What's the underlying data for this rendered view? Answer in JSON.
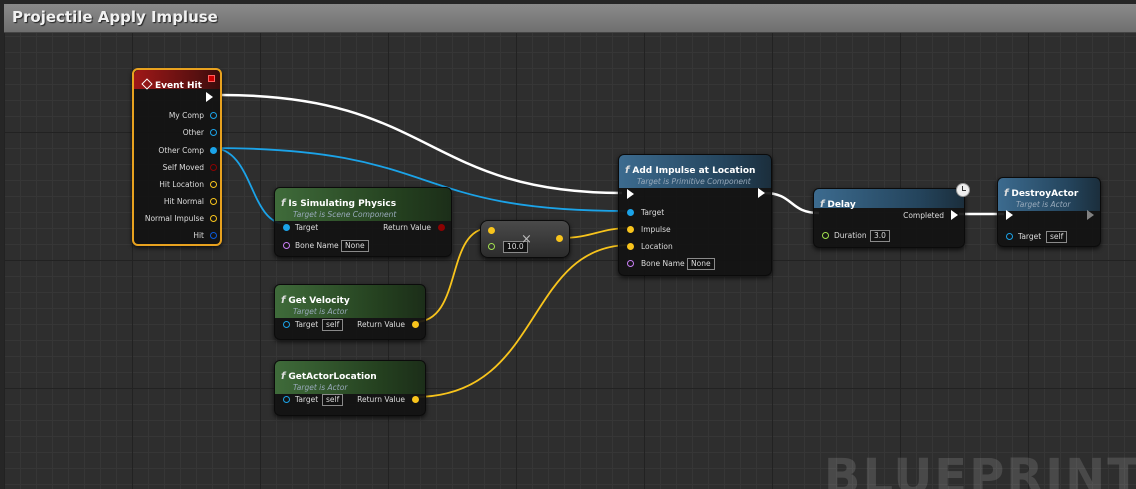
{
  "editor": {
    "title": "Projectile Apply Impluse",
    "watermark": "BLUEPRINT"
  },
  "colors": {
    "exec": "#ffffff",
    "object": "#1ba3e8",
    "vector": "#f8c41c",
    "float": "#a2e04e",
    "bool": "#8c0202",
    "struct": "#0a5adb",
    "name": "#c97ff5",
    "selection": "#e8a21f"
  },
  "nodes": {
    "event_hit": {
      "title": "Event Hit",
      "pins": [
        "My Comp",
        "Other",
        "Other Comp",
        "Self Moved",
        "Hit Location",
        "Hit Normal",
        "Normal Impulse",
        "Hit"
      ]
    },
    "is_simulating": {
      "title": "Is Simulating Physics",
      "subtitle": "Target is Scene Component",
      "target": "Target",
      "return_value": "Return Value",
      "bone_name": "Bone Name",
      "bone_value": "None"
    },
    "get_velocity": {
      "title": "Get Velocity",
      "subtitle": "Target is Actor",
      "target": "Target",
      "target_value": "self",
      "return_value": "Return Value"
    },
    "get_actor_location": {
      "title": "GetActorLocation",
      "subtitle": "Target is Actor",
      "target": "Target",
      "target_value": "self",
      "return_value": "Return Value"
    },
    "multiply": {
      "symbol": "×",
      "value": "10.0"
    },
    "add_impulse": {
      "title": "Add Impulse at Location",
      "subtitle": "Target is Primitive Component",
      "target": "Target",
      "impulse": "Impulse",
      "location": "Location",
      "bone_name": "Bone Name",
      "bone_value": "None"
    },
    "delay": {
      "title": "Delay",
      "completed": "Completed",
      "duration": "Duration",
      "duration_value": "3.0"
    },
    "destroy_actor": {
      "title": "DestroyActor",
      "subtitle": "Target is Actor",
      "target": "Target",
      "target_value": "self"
    }
  }
}
